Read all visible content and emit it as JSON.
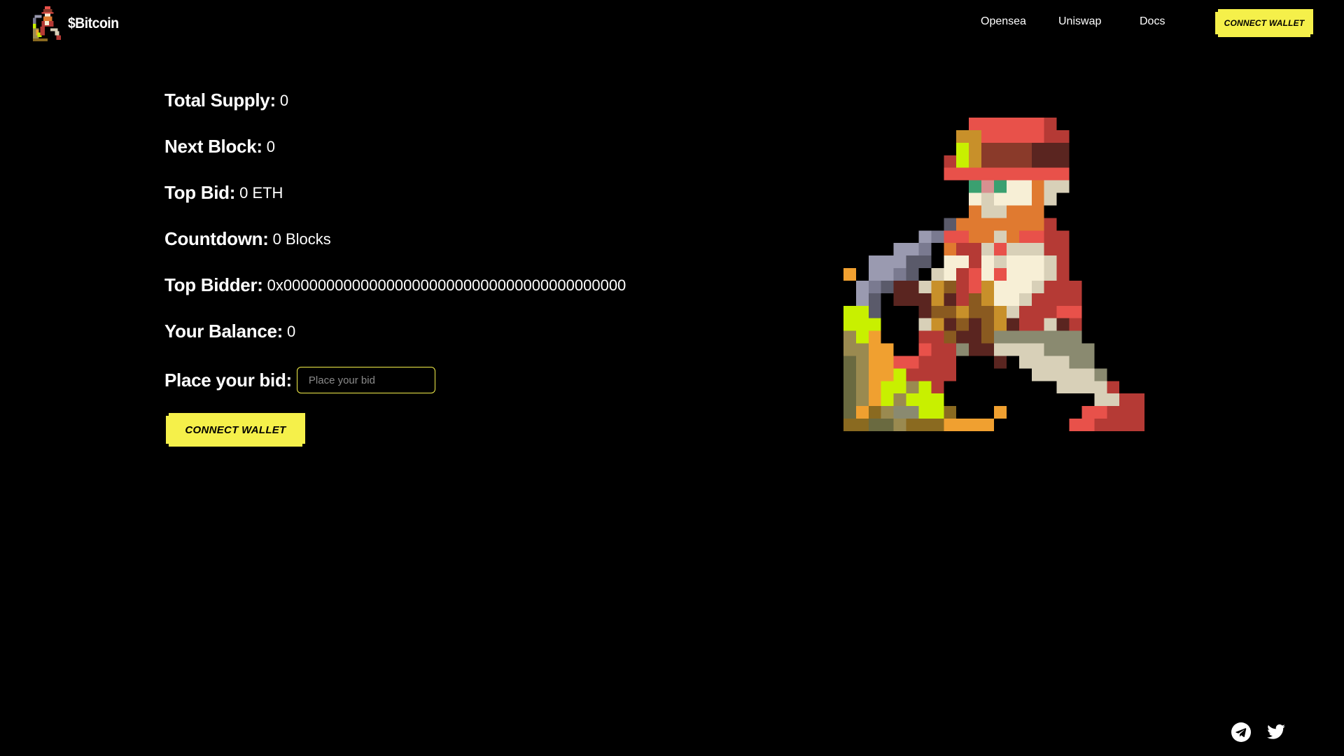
{
  "brand": {
    "name": "$Bitcoin",
    "logo_icon": "pixel-miner-icon"
  },
  "nav": {
    "items": [
      {
        "label": "Opensea"
      },
      {
        "label": "Uniswap"
      },
      {
        "label": "Docs"
      }
    ],
    "connect_label": "CONNECT WALLET"
  },
  "stats": {
    "total_supply": {
      "label": "Total Supply:",
      "value": "0"
    },
    "next_block": {
      "label": "Next Block:",
      "value": "0"
    },
    "top_bid": {
      "label": "Top Bid:",
      "value": "0 ETH"
    },
    "countdown": {
      "label": "Countdown:",
      "value": "0 Blocks"
    },
    "top_bidder": {
      "label": "Top Bidder:",
      "value": "0x0000000000000000000000000000000000000000"
    },
    "your_balance": {
      "label": "Your Balance:",
      "value": "0"
    }
  },
  "bid": {
    "label": "Place your bid:",
    "placeholder": "Place your bid",
    "value": ""
  },
  "main_button": {
    "label": "CONNECT WALLET"
  },
  "hero": {
    "icon": "pixel-bitcoin-miner-icon"
  },
  "social": {
    "icons": [
      "telegram-icon",
      "twitter-icon"
    ]
  },
  "colors": {
    "background": "#000000",
    "accent": "#f5f04a",
    "text": "#ffffff"
  }
}
